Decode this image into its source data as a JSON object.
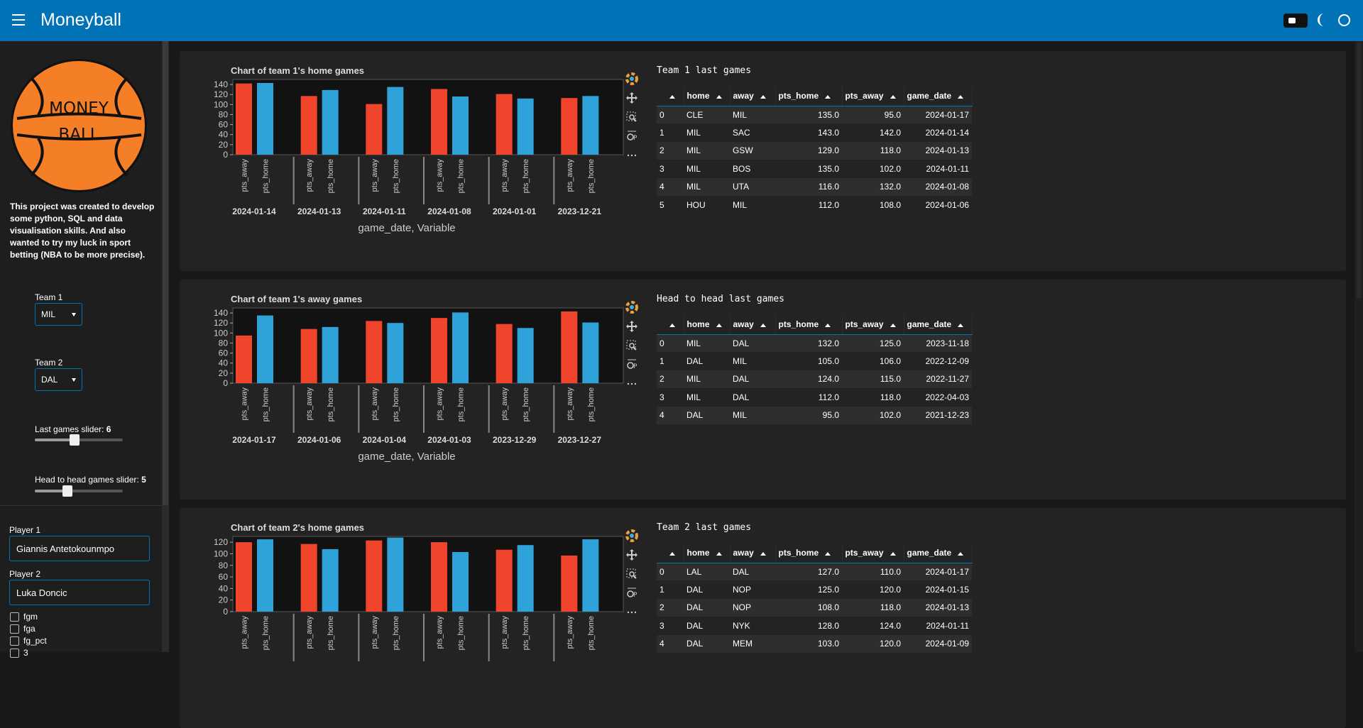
{
  "app": {
    "title": "Moneyball"
  },
  "sidebar": {
    "logo_text": [
      "MONEY",
      "BALL"
    ],
    "description": "This project was created to develop some python, SQL and data visualisation skills. And also wanted to try my luck in sport betting (NBA to be more precise).",
    "team1": {
      "label": "Team 1",
      "value": "MIL"
    },
    "team2": {
      "label": "Team 2",
      "value": "DAL"
    },
    "last_games_slider": {
      "label": "Last games slider: ",
      "value": "6",
      "fraction": 0.45
    },
    "h2h_slider": {
      "label": "Head to head games slider: ",
      "value": "5",
      "fraction": 0.37
    },
    "player1": {
      "label": "Player 1",
      "value": "Giannis Antetokounmpo"
    },
    "player2": {
      "label": "Player 2",
      "value": "Luka Doncic"
    },
    "stats": [
      "fgm",
      "fga",
      "fg_pct",
      "3"
    ]
  },
  "colors": {
    "away": "#f0442c",
    "home": "#30a2da",
    "accent": "#0072b5"
  },
  "panels": [
    {
      "table_title": "Team 1 last games",
      "columns": [
        "",
        "home",
        "away",
        "pts_home",
        "pts_away",
        "game_date"
      ],
      "rows": [
        [
          "0",
          "CLE",
          "MIL",
          "135.0",
          "95.0",
          "2024-01-17"
        ],
        [
          "1",
          "MIL",
          "SAC",
          "143.0",
          "142.0",
          "2024-01-14"
        ],
        [
          "2",
          "MIL",
          "GSW",
          "129.0",
          "118.0",
          "2024-01-13"
        ],
        [
          "3",
          "MIL",
          "BOS",
          "135.0",
          "102.0",
          "2024-01-11"
        ],
        [
          "4",
          "MIL",
          "UTA",
          "116.0",
          "132.0",
          "2024-01-08"
        ],
        [
          "5",
          "HOU",
          "MIL",
          "112.0",
          "108.0",
          "2024-01-06"
        ]
      ]
    },
    {
      "table_title": "Head to head last games",
      "columns": [
        "",
        "home",
        "away",
        "pts_home",
        "pts_away",
        "game_date"
      ],
      "rows": [
        [
          "0",
          "MIL",
          "DAL",
          "132.0",
          "125.0",
          "2023-11-18"
        ],
        [
          "1",
          "DAL",
          "MIL",
          "105.0",
          "106.0",
          "2022-12-09"
        ],
        [
          "2",
          "MIL",
          "DAL",
          "124.0",
          "115.0",
          "2022-11-27"
        ],
        [
          "3",
          "MIL",
          "DAL",
          "112.0",
          "118.0",
          "2022-04-03"
        ],
        [
          "4",
          "DAL",
          "MIL",
          "95.0",
          "102.0",
          "2021-12-23"
        ]
      ]
    },
    {
      "table_title": "Team 2 last games",
      "columns": [
        "",
        "home",
        "away",
        "pts_home",
        "pts_away",
        "game_date"
      ],
      "rows": [
        [
          "0",
          "LAL",
          "DAL",
          "127.0",
          "110.0",
          "2024-01-17"
        ],
        [
          "1",
          "DAL",
          "NOP",
          "125.0",
          "120.0",
          "2024-01-15"
        ],
        [
          "2",
          "DAL",
          "NOP",
          "108.0",
          "118.0",
          "2024-01-13"
        ],
        [
          "3",
          "DAL",
          "NYK",
          "128.0",
          "124.0",
          "2024-01-11"
        ],
        [
          "4",
          "DAL",
          "MEM",
          "103.0",
          "120.0",
          "2024-01-09"
        ]
      ]
    }
  ],
  "chart_data": [
    {
      "type": "bar",
      "title": "Chart of team 1's home games",
      "xlabel": "game_date, Variable",
      "categories": [
        "2024-01-14",
        "2024-01-13",
        "2024-01-11",
        "2024-01-08",
        "2024-01-01",
        "2023-12-21"
      ],
      "sub_categories": [
        "pts_away",
        "pts_home"
      ],
      "series": [
        {
          "name": "pts_away",
          "values": [
            142,
            117,
            101,
            131,
            121,
            113
          ]
        },
        {
          "name": "pts_home",
          "values": [
            143,
            129,
            135,
            116,
            112,
            117
          ]
        }
      ],
      "yticks": [
        0,
        20,
        40,
        60,
        80,
        100,
        120,
        140
      ],
      "ylim": [
        0,
        150
      ]
    },
    {
      "type": "bar",
      "title": "Chart of team 1's away games",
      "xlabel": "game_date, Variable",
      "categories": [
        "2024-01-17",
        "2024-01-06",
        "2024-01-04",
        "2024-01-03",
        "2023-12-29",
        "2023-12-27"
      ],
      "sub_categories": [
        "pts_away",
        "pts_home"
      ],
      "series": [
        {
          "name": "pts_away",
          "values": [
            95,
            108,
            124,
            130,
            118,
            143
          ]
        },
        {
          "name": "pts_home",
          "values": [
            135,
            112,
            120,
            141,
            110,
            121
          ]
        }
      ],
      "yticks": [
        0,
        20,
        40,
        60,
        80,
        100,
        120,
        140
      ],
      "ylim": [
        0,
        150
      ]
    },
    {
      "type": "bar",
      "title": "Chart of team 2's home games",
      "xlabel": "",
      "categories": [
        "",
        "",
        "",
        "",
        "",
        ""
      ],
      "sub_categories": [
        "pts_away",
        "pts_home"
      ],
      "series": [
        {
          "name": "pts_away",
          "values": [
            120,
            117,
            123,
            120,
            107,
            97
          ]
        },
        {
          "name": "pts_home",
          "values": [
            125,
            108,
            128,
            103,
            115,
            125
          ]
        }
      ],
      "yticks": [
        0,
        20,
        40,
        60,
        80,
        100,
        120
      ],
      "ylim": [
        0,
        130
      ]
    }
  ]
}
